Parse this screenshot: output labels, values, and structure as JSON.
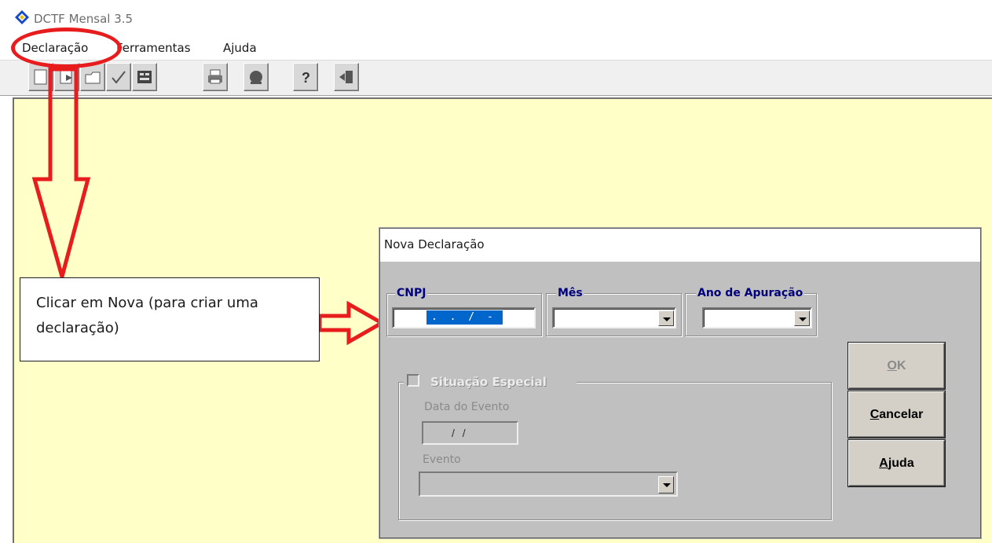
{
  "app": {
    "title": "DCTF Mensal 3.5",
    "icon": "diamond-logo-icon"
  },
  "menu": {
    "items": [
      "Declaração",
      "Ferramentas",
      "Ajuda"
    ]
  },
  "toolbar": {
    "buttons": [
      "new-document-icon",
      "open-document-icon",
      "folder-icon",
      "checkmark-icon",
      "form-icon",
      "printer-icon",
      "globe-icon",
      "help-icon",
      "exit-icon"
    ]
  },
  "callout": {
    "text": "Clicar em Nova (para criar uma declaração)"
  },
  "dialog": {
    "title": "Nova Declaração",
    "cnpj": {
      "label": "CNPJ",
      "mask": ". . / -"
    },
    "mes": {
      "label": "Mês",
      "value": ""
    },
    "ano": {
      "label": "Ano de Apuração",
      "value": ""
    },
    "situacao": {
      "label": "Situação Especial",
      "checked": false
    },
    "data_evento": {
      "label": "Data do Evento",
      "value": "/ /"
    },
    "evento": {
      "label": "Evento",
      "value": ""
    },
    "buttons": {
      "ok": "OK",
      "cancelar": "Cancelar",
      "ajuda": "Ajuda"
    }
  },
  "colors": {
    "workspace": "#ffffc8",
    "dialog_bg": "#c0c0c0",
    "group_label": "#00007a",
    "annotation": "#e81c1c",
    "selection": "#0066cc"
  }
}
